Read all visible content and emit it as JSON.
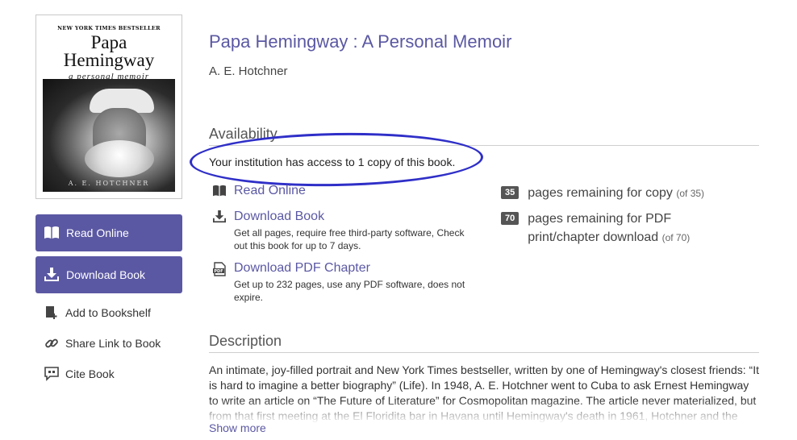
{
  "book": {
    "title": "Papa Hemingway : A Personal Memoir",
    "author": "A. E. Hotchner",
    "cover": {
      "banner": "NEW YORK TIMES BESTSELLER",
      "title_line1": "Papa",
      "title_line2": "Hemingway",
      "subtitle": "a personal memoir",
      "author": "A. E. HOTCHNER"
    }
  },
  "sidebar": {
    "read_online": "Read Online",
    "download_book": "Download Book",
    "add_to_bookshelf": "Add to Bookshelf",
    "share_link": "Share Link to Book",
    "cite_book": "Cite Book"
  },
  "availability": {
    "heading": "Availability",
    "access_text": "Your institution has access to 1 copy of this book.",
    "options": {
      "read_online": {
        "label": "Read Online"
      },
      "download_book": {
        "label": "Download Book",
        "note": "Get all pages, require free third-party software, Check out this book for up to 7 days."
      },
      "download_pdf": {
        "label": "Download PDF Chapter",
        "note": "Get up to 232 pages, use any PDF software, does not expire."
      }
    },
    "remaining": {
      "copy": {
        "count": "35",
        "text": "pages remaining for copy",
        "of": "(of 35)"
      },
      "pdf": {
        "count": "70",
        "text": "pages remaining for PDF print/chapter download",
        "of": "(of 70)"
      }
    }
  },
  "description": {
    "heading": "Description",
    "text": "An intimate, joy-filled portrait and New York Times bestseller, written by one of Hemingway's closest friends: “It is hard to imagine a better biography” (Life). In 1948, A. E. Hotchner went to Cuba to ask Ernest Hemingway to write an article on “The Future of Literature” for Cosmopolitan magazine. The article never materialized, but from that first meeting at the El Floridita bar in Havana until Hemingway's death in 1961, Hotchner and the",
    "show_more": "Show more"
  },
  "colors": {
    "accent": "#5b58a3",
    "annotation_oval": "#2f2fc8",
    "badge": "#555555"
  }
}
